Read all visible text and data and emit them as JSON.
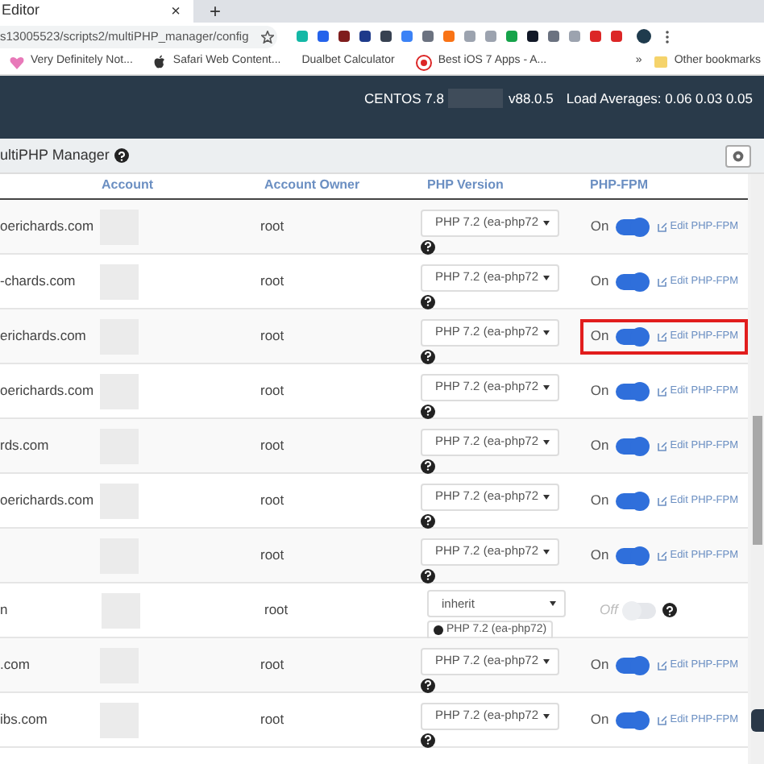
{
  "tab": {
    "title": "Editor",
    "close": "×",
    "new_tab": "+"
  },
  "address": {
    "url": "s13005523/scripts2/multiPHP_manager/config"
  },
  "bookmarks": [
    {
      "label": "Very Definitely Not..."
    },
    {
      "label": "Safari Web Content..."
    },
    {
      "label": "Dualbet Calculator"
    },
    {
      "label": "Best iOS 7 Apps - A..."
    }
  ],
  "bookmarks_more": "»",
  "other_bookmarks": "Other bookmarks",
  "server_header": {
    "os": "CENTOS 7.8",
    "version": "v88.0.5",
    "load": "Load Averages: 0.06 0.03 0.05"
  },
  "page_title": "ultiPHP Manager",
  "table": {
    "columns": [
      "Account",
      "Account Owner",
      "PHP Version",
      "PHP-FPM"
    ],
    "rows": [
      {
        "domain": "oerichards.com",
        "owner": "root",
        "php": "PHP 7.2 (ea-php72",
        "on": true,
        "status": "On",
        "edit": "Edit PHP-FPM",
        "highlighted": false
      },
      {
        "domain": "-chards.com",
        "owner": "root",
        "php": "PHP 7.2 (ea-php72",
        "on": true,
        "status": "On",
        "edit": "Edit PHP-FPM",
        "highlighted": false
      },
      {
        "domain": "erichards.com",
        "owner": "root",
        "php": "PHP 7.2 (ea-php72",
        "on": true,
        "status": "On",
        "edit": "Edit PHP-FPM",
        "highlighted": true
      },
      {
        "domain": "oerichards.com",
        "owner": "root",
        "php": "PHP 7.2 (ea-php72",
        "on": true,
        "status": "On",
        "edit": "Edit PHP-FPM",
        "highlighted": false
      },
      {
        "domain": "rds.com",
        "owner": "root",
        "php": "PHP 7.2 (ea-php72",
        "on": true,
        "status": "On",
        "edit": "Edit PHP-FPM",
        "highlighted": false
      },
      {
        "domain": "oerichards.com",
        "owner": "root",
        "php": "PHP 7.2 (ea-php72",
        "on": true,
        "status": "On",
        "edit": "Edit PHP-FPM",
        "highlighted": false
      },
      {
        "owner": "root",
        "php": "PHP 7.2 (ea-php72",
        "on": true,
        "status": "On",
        "edit": "Edit PHP-FPM",
        "highlighted": false
      },
      {
        "domain": "n",
        "owner": "root",
        "php": "inherit",
        "note": "PHP 7.2 (ea-php72)",
        "on": false,
        "status": "Off",
        "highlighted": false
      },
      {
        "domain": ".com",
        "owner": "root",
        "php": "PHP 7.2 (ea-php72",
        "on": true,
        "status": "On",
        "edit": "Edit PHP-FPM",
        "highlighted": false
      },
      {
        "domain": "ibs.com",
        "owner": "root",
        "php": "PHP 7.2 (ea-php72",
        "on": true,
        "status": "On",
        "edit": "Edit PHP-FPM",
        "highlighted": false
      }
    ]
  }
}
